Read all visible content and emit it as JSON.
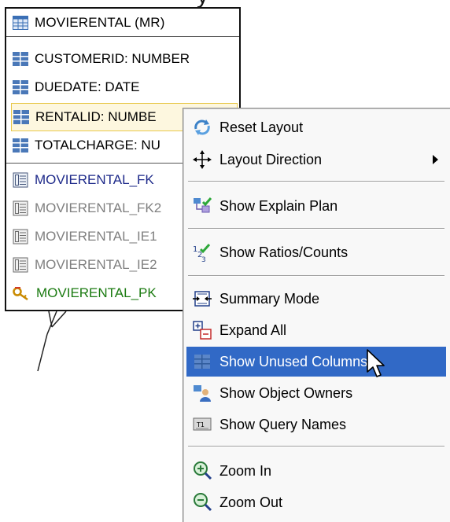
{
  "top_fragment": "y",
  "entity": {
    "title": "MOVIERENTAL (MR)",
    "columns": [
      {
        "label": "CUSTOMERID: NUMBER"
      },
      {
        "label": "DUEDATE: DATE"
      },
      {
        "label": "RENTALID: NUMBE"
      },
      {
        "label": "TOTALCHARGE: NU"
      }
    ],
    "keys": [
      {
        "label": "MOVIERENTAL_FK",
        "kind": "fk"
      },
      {
        "label": "MOVIERENTAL_FK2",
        "kind": "index"
      },
      {
        "label": "MOVIERENTAL_IE1",
        "kind": "index"
      },
      {
        "label": "MOVIERENTAL_IE2",
        "kind": "index"
      },
      {
        "label": "MOVIERENTAL_PK",
        "kind": "pk"
      }
    ]
  },
  "menu": {
    "items": [
      {
        "label": "Reset Layout",
        "icon": "reset-layout-icon"
      },
      {
        "label": "Layout Direction",
        "icon": "layout-direction-icon",
        "submenu": true
      },
      {
        "label": "Show Explain Plan",
        "icon": "explain-plan-icon"
      },
      {
        "label": "Show Ratios/Counts",
        "icon": "ratios-counts-icon"
      },
      {
        "label": "Summary Mode",
        "icon": "summary-mode-icon"
      },
      {
        "label": "Expand All",
        "icon": "expand-all-icon"
      },
      {
        "label": "Show Unused Columns",
        "icon": "unused-columns-icon",
        "highlighted": true
      },
      {
        "label": "Show Object Owners",
        "icon": "object-owners-icon"
      },
      {
        "label": "Show Query Names",
        "icon": "query-names-icon"
      },
      {
        "label": "Zoom In",
        "icon": "zoom-in-icon"
      },
      {
        "label": "Zoom Out",
        "icon": "zoom-out-icon"
      }
    ]
  },
  "colors": {
    "menu_highlight": "#3169c6",
    "fk_text": "#1e2a8a",
    "index_text": "#7f7f7f",
    "pk_text": "#1a7a10",
    "selected_row_bg": "#fdf7df"
  }
}
